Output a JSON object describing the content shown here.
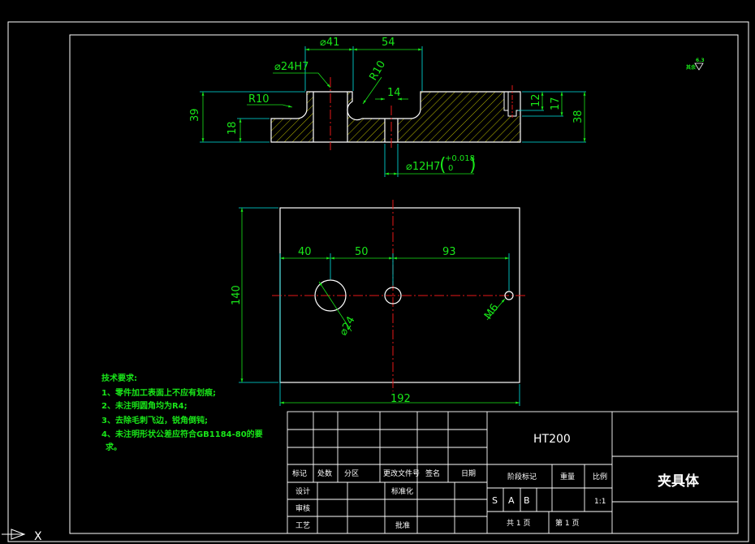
{
  "section_view": {
    "dims": {
      "bore_dia": "⌀41",
      "offset": "54",
      "pin_hole": "⌀24H7",
      "radius_top": "R10",
      "radius_left": "R10",
      "slot_width": "14",
      "height_total": "39",
      "step_height": "18",
      "counterbore_a": "12",
      "counterbore_b": "17",
      "height_right": "38",
      "slot_fit": "⌀12H7",
      "tol_upper": "+0.018",
      "tol_lower": "0"
    }
  },
  "plan_view": {
    "dims": {
      "a": "40",
      "b": "50",
      "c": "93",
      "width": "140",
      "length": "192",
      "hole_dia": "⌀24",
      "thread": "M6"
    }
  },
  "roughness_note": "其余",
  "roughness_value": "6.3",
  "tech_requirements": {
    "title": "技术要求:",
    "lines": [
      "1、零件加工表面上不应有划痕;",
      "2、未注明圆角均为R4;",
      "3、去除毛刺飞边，锐角倒钝;",
      "4、未注明形状公差应符合GB1184-80的要",
      "求。"
    ]
  },
  "title_block": {
    "material": "HT200",
    "part_name": "夹具体",
    "rev_headers": [
      "标记",
      "处数",
      "分区",
      "更改文件号",
      "签名",
      "日期"
    ],
    "row_labels": [
      "设计",
      "审核",
      "工艺"
    ],
    "standardize": "标准化",
    "approve": "批准",
    "stage_mark": "阶段标记",
    "weight": "重量",
    "scale_label": "比例",
    "scale_value": "1:1",
    "stage_letters": [
      "S",
      "A",
      "B"
    ],
    "sheets_total": "共 1 页",
    "sheet_no": "第 1 页"
  },
  "colors": {
    "background": "#000000",
    "outline": "#ffffff",
    "dimension": "#19e619",
    "center_line": "#e61919",
    "extension": "#00e5e5",
    "hatch": "#b8b800"
  }
}
